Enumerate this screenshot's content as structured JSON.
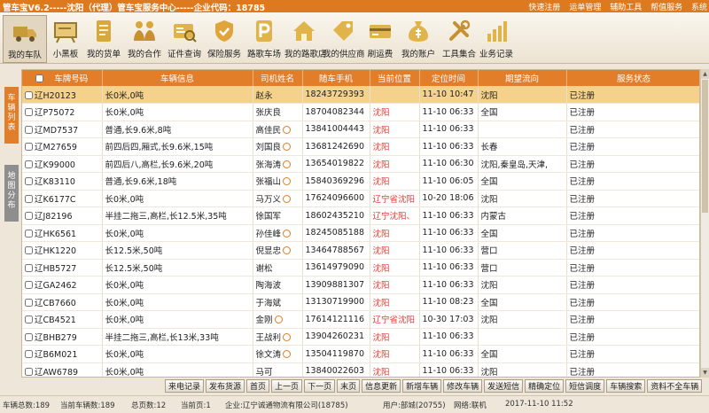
{
  "window": {
    "title": "管车宝V6.2-----沈阳（代理）管车宝服务中心-----企业代码：18785",
    "menu": [
      "快速注册",
      "运单管理",
      "辅助工具",
      "帮值服务",
      "系统"
    ]
  },
  "toolbar": [
    {
      "label": "我的车队",
      "icon": "truck-icon",
      "active": true
    },
    {
      "label": "小黑板",
      "icon": "blackboard-icon"
    },
    {
      "label": "我的货单",
      "icon": "document-icon"
    },
    {
      "label": "我的合作",
      "icon": "handshake-icon"
    },
    {
      "label": "证件查询",
      "icon": "id-card-icon"
    },
    {
      "label": "保险服务",
      "icon": "shield-icon"
    },
    {
      "label": "路歌车场",
      "icon": "parking-icon"
    },
    {
      "label": "我的路歌店",
      "icon": "house-icon"
    },
    {
      "label": "我的供应商",
      "icon": "tag-icon"
    },
    {
      "label": "刷运费",
      "icon": "card-icon"
    },
    {
      "label": "我的账户",
      "icon": "money-bag-icon"
    },
    {
      "label": "工具集合",
      "icon": "tools-icon"
    },
    {
      "label": "业务记录",
      "icon": "chart-icon"
    }
  ],
  "side_tabs": [
    "车辆列表",
    "地图分布"
  ],
  "table": {
    "columns": [
      "车牌号码",
      "车辆信息",
      "司机姓名",
      "随车手机",
      "当前位置",
      "定位时间",
      "期望流向",
      "服务状态"
    ],
    "rows": [
      {
        "plate": "辽H20123",
        "info": "长0米,0吨",
        "driver": "赵永",
        "badge": false,
        "phone": "18243729393",
        "loc": "",
        "time": "11-10 10:47",
        "dest": "沈阳",
        "status": "已注册",
        "selected": true
      },
      {
        "plate": "辽P75072",
        "info": "长0米,0吨",
        "driver": "张庆良",
        "badge": false,
        "phone": "18704082344",
        "loc": "沈阳",
        "time": "11-10 06:33",
        "dest": "全国",
        "status": "已注册"
      },
      {
        "plate": "辽MD7537",
        "info": "普通,长9.6米,8吨",
        "driver": "高佳民",
        "badge": true,
        "phone": "13841004443",
        "loc": "沈阳",
        "time": "11-10 06:33",
        "dest": "",
        "status": "已注册"
      },
      {
        "plate": "辽M27659",
        "info": "前四后四,厢式,长9.6米,15吨",
        "driver": "刘国良",
        "badge": true,
        "phone": "13681242690",
        "loc": "沈阳",
        "time": "11-10 06:33",
        "dest": "长春",
        "status": "已注册"
      },
      {
        "plate": "辽K99000",
        "info": "前四后八,高栏,长9.6米,20吨",
        "driver": "张海涛",
        "badge": true,
        "phone": "13654019822",
        "loc": "沈阳",
        "time": "11-10 06:30",
        "dest": "沈阳,秦皇岛,天津,",
        "status": "已注册"
      },
      {
        "plate": "辽K83110",
        "info": "普通,长9.6米,18吨",
        "driver": "张福山",
        "badge": true,
        "phone": "15840369296",
        "loc": "沈阳",
        "time": "11-10 06:05",
        "dest": "全国",
        "status": "已注册"
      },
      {
        "plate": "辽K6177C",
        "info": "长0米,0吨",
        "driver": "马万义",
        "badge": true,
        "phone": "17624096600",
        "loc": "辽宁省沈阳",
        "time": "10-20 18:06",
        "dest": "沈阳",
        "status": "已注册"
      },
      {
        "plate": "辽J82196",
        "info": "半挂二拖三,高栏,长12.5米,35吨",
        "driver": "徐国军",
        "badge": false,
        "phone": "18602435210",
        "loc": "辽宁沈阳、",
        "time": "11-10 06:33",
        "dest": "内蒙古",
        "status": "已注册"
      },
      {
        "plate": "辽HK6561",
        "info": "长0米,0吨",
        "driver": "孙佳峰",
        "badge": true,
        "phone": "18245085188",
        "loc": "沈阳",
        "time": "11-10 06:33",
        "dest": "全国",
        "status": "已注册"
      },
      {
        "plate": "辽HK1220",
        "info": "长12.5米,50吨",
        "driver": "倪显忠",
        "badge": true,
        "phone": "13464788567",
        "loc": "沈阳",
        "time": "11-10 06:33",
        "dest": "营口",
        "status": "已注册"
      },
      {
        "plate": "辽HB5727",
        "info": "长12.5米,50吨",
        "driver": "谢松",
        "badge": false,
        "phone": "13614979090",
        "loc": "沈阳",
        "time": "11-10 06:33",
        "dest": "营口",
        "status": "已注册"
      },
      {
        "plate": "辽GA2462",
        "info": "长0米,0吨",
        "driver": "陶海波",
        "badge": false,
        "phone": "13909881307",
        "loc": "沈阳",
        "time": "11-10 06:33",
        "dest": "沈阳",
        "status": "已注册"
      },
      {
        "plate": "辽CB7660",
        "info": "长0米,0吨",
        "driver": "于海斌",
        "badge": false,
        "phone": "13130719900",
        "loc": "沈阳",
        "time": "11-10 08:23",
        "dest": "全国",
        "status": "已注册"
      },
      {
        "plate": "辽CB4521",
        "info": "长0米,0吨",
        "driver": "金刚",
        "badge": true,
        "phone": "17614121116",
        "loc": "辽宁省沈阳",
        "time": "10-30 17:03",
        "dest": "沈阳",
        "status": "已注册"
      },
      {
        "plate": "辽BHB279",
        "info": "半挂二拖三,高栏,长13米,33吨",
        "driver": "王战利",
        "badge": true,
        "phone": "13904260231",
        "loc": "沈阳",
        "time": "11-10 06:33",
        "dest": "",
        "status": "已注册"
      },
      {
        "plate": "辽B6M021",
        "info": "长0米,0吨",
        "driver": "徐文涛",
        "badge": true,
        "phone": "13504119870",
        "loc": "沈阳",
        "time": "11-10 06:33",
        "dest": "全国",
        "status": "已注册"
      },
      {
        "plate": "辽AW6789",
        "info": "长0米,0吨",
        "driver": "马可",
        "badge": false,
        "phone": "13840022603",
        "loc": "沈阳",
        "time": "11-10 06:33",
        "dest": "沈阳",
        "status": "已注册"
      }
    ]
  },
  "buttons": [
    "来电记录",
    "发布货源",
    "首页",
    "上一页",
    "下一页",
    "末页",
    "信息更新",
    "新增车辆",
    "修改车辆",
    "发送短信",
    "精确定位",
    "短信调度",
    "车辆搜索",
    "资料不全车辆"
  ],
  "status": {
    "total": "车辆总数:189",
    "current": "当前车辆数:189",
    "pages": "总页数:12",
    "page": "当前页:1",
    "company": "企业:辽宁诚通物流有限公司(18785)",
    "user": "用户:部城(20755)",
    "network": "网络:联机",
    "datetime": "2017-11-10 11:52"
  }
}
